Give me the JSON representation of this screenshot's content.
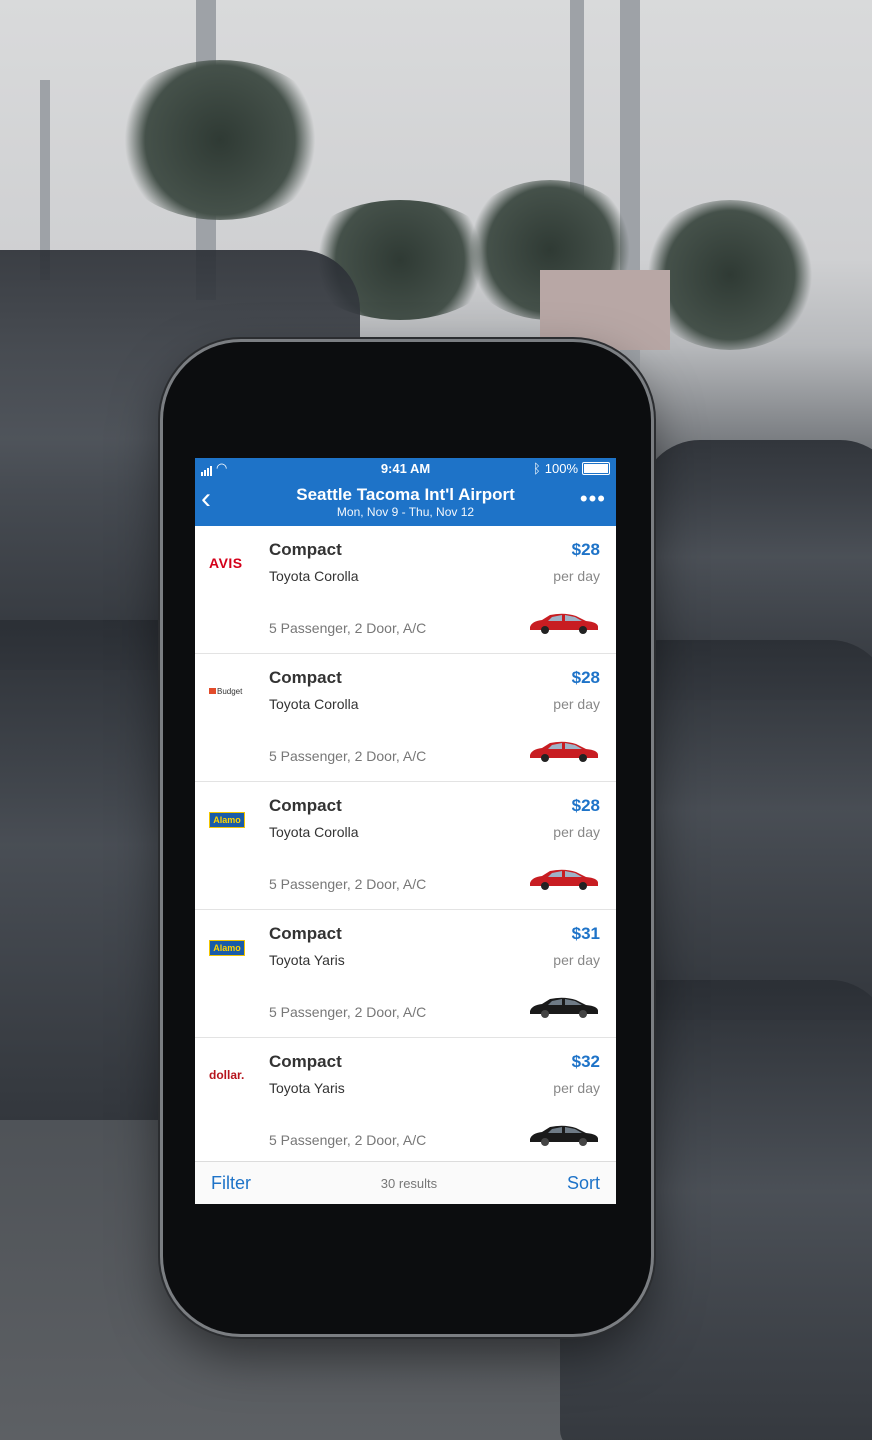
{
  "status_bar": {
    "time": "9:41 AM",
    "battery": "100%"
  },
  "header": {
    "title": "Seattle Tacoma Int'l Airport",
    "subtitle": "Mon, Nov 9 - Thu, Nov 12"
  },
  "results": [
    {
      "vendor": "AVIS",
      "class": "Compact",
      "model": "Toyota Corolla",
      "specs": "5 Passenger, 2 Door, A/C",
      "price": "$28",
      "unit": "per day",
      "car_color": "#c81d22"
    },
    {
      "vendor": "Budget",
      "class": "Compact",
      "model": "Toyota Corolla",
      "specs": "5 Passenger, 2 Door, A/C",
      "price": "$28",
      "unit": "per day",
      "car_color": "#c81d22"
    },
    {
      "vendor": "Alamo",
      "class": "Compact",
      "model": "Toyota Corolla",
      "specs": "5 Passenger, 2 Door, A/C",
      "price": "$28",
      "unit": "per day",
      "car_color": "#c81d22"
    },
    {
      "vendor": "Alamo",
      "class": "Compact",
      "model": "Toyota Yaris",
      "specs": "5 Passenger, 2 Door, A/C",
      "price": "$31",
      "unit": "per day",
      "car_color": "#1a1a1a"
    },
    {
      "vendor": "dollar.",
      "class": "Compact",
      "model": "Toyota Yaris",
      "specs": "5 Passenger, 2 Door, A/C",
      "price": "$32",
      "unit": "per day",
      "car_color": "#1a1a1a"
    }
  ],
  "footer": {
    "filter_label": "Filter",
    "results_count": "30 results",
    "sort_label": "Sort"
  },
  "colors": {
    "accent": "#1e73c8"
  }
}
